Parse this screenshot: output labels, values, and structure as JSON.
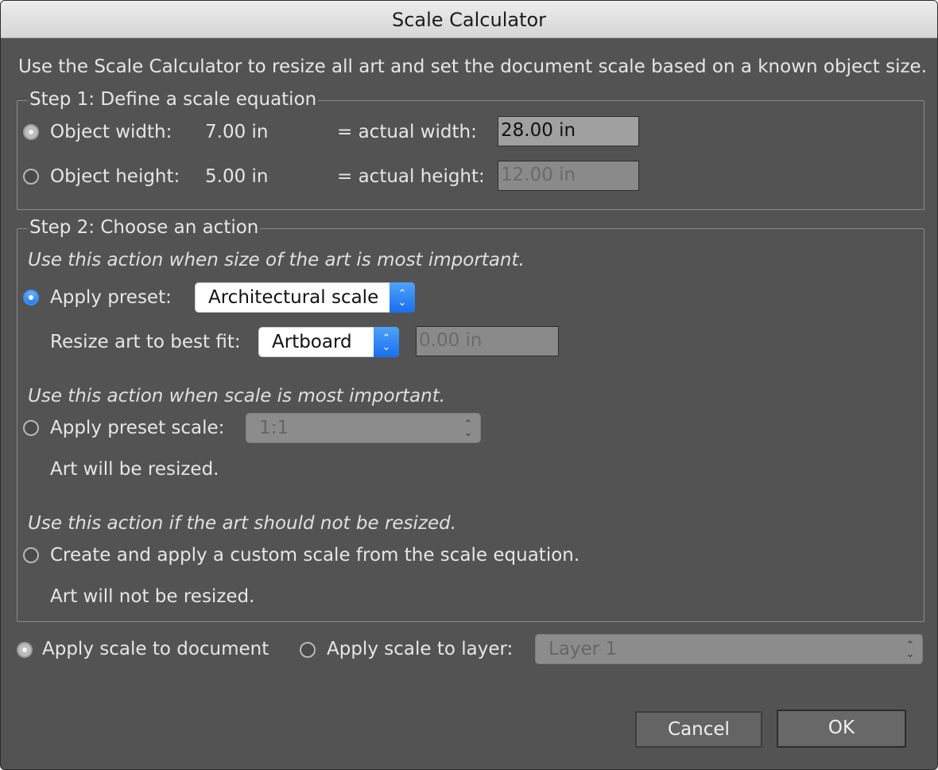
{
  "window": {
    "title": "Scale Calculator"
  },
  "description": "Use the Scale Calculator to resize all art and set the document scale based on a known object size.",
  "step1": {
    "legend": "Step 1: Define a scale equation",
    "width_row": {
      "label": "Object width:",
      "value": "7.00 in",
      "eq_label": "= actual width:",
      "input_value": "28.00 in",
      "selected": true
    },
    "height_row": {
      "label": "Object height:",
      "value": "5.00 in",
      "eq_label": "= actual height:",
      "input_value": "12.00 in",
      "selected": false
    }
  },
  "step2": {
    "legend": "Step 2: Choose an action",
    "hint1": "Use this action when size of the art is most important.",
    "apply_preset": {
      "label": "Apply preset:",
      "selected_value": "Architectural scale",
      "selected": true
    },
    "resize_fit": {
      "label": "Resize art to best fit:",
      "selected_value": "Artboard",
      "input_value": "0.00 in"
    },
    "hint2": "Use this action when scale is most important.",
    "apply_preset_scale": {
      "label": "Apply preset scale:",
      "selected_value": "1:1",
      "selected": false
    },
    "note1": "Art will be resized.",
    "hint3": "Use this action if the art should not be resized.",
    "custom_scale": {
      "label": "Create and apply a custom scale from the scale equation.",
      "selected": false
    },
    "note2": "Art will not be resized."
  },
  "apply_target": {
    "document_label": "Apply scale to document",
    "layer_label": "Apply scale to layer:",
    "layer_value": "Layer 1",
    "document_selected": true
  },
  "buttons": {
    "cancel": "Cancel",
    "ok": "OK"
  },
  "icons": {
    "popup_chevron": "chevron-up-down-icon",
    "radio": "radio-button"
  },
  "colors": {
    "accent": "#1f7ef0",
    "panel_bg": "#535353",
    "titlebar_bg": "#dcdcdc"
  }
}
